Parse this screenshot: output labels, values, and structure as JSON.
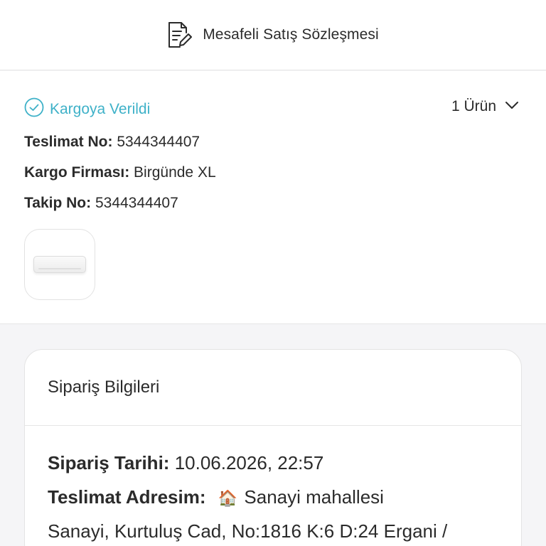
{
  "contract": {
    "label": "Mesafeli Satış Sözleşmesi",
    "icon": "document-edit-icon"
  },
  "shipment": {
    "status": "Kargoya Verildi",
    "status_color": "#3eb1c8",
    "products_count": "1 Ürün",
    "delivery_no_label": "Teslimat No:",
    "delivery_no": "5344344407",
    "carrier_label": "Kargo Firması:",
    "carrier": "Birgünde XL",
    "tracking_label": "Takip No:",
    "tracking_no": "5344344407"
  },
  "order_info": {
    "title": "Sipariş Bilgileri",
    "date_label": "Sipariş Tarihi:",
    "date": "10.06.2026, 22:57",
    "address_label": "Teslimat Adresim:",
    "address_icon": "🏠",
    "address_name": "Sanayi mahallesi",
    "address_line": "Sanayi, Kurtuluş Cad, No:1816 K:6 D:24 Ergani /"
  }
}
